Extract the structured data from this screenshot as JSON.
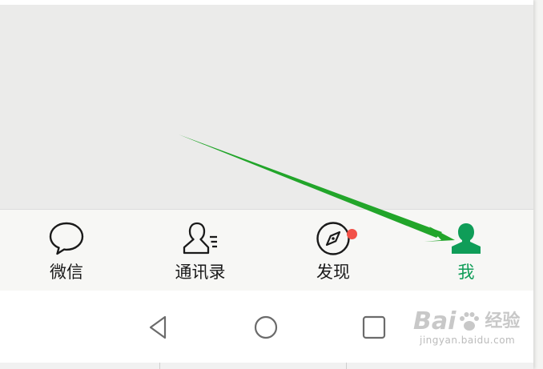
{
  "tabbar": {
    "tabs": [
      {
        "label": "微信",
        "icon": "chat-bubble-icon"
      },
      {
        "label": "通讯录",
        "icon": "contacts-icon"
      },
      {
        "label": "发现",
        "icon": "compass-icon",
        "has_badge": true
      },
      {
        "label": "我",
        "icon": "person-icon",
        "active": true
      }
    ]
  },
  "android_nav": {
    "back": "back-triangle-icon",
    "home": "home-circle-icon",
    "recent": "recent-square-icon"
  },
  "annotation": {
    "type": "arrow",
    "color": "#22a52a",
    "points_to": "我"
  },
  "watermark": {
    "brand": "Bai",
    "brand_suffix": "经验",
    "url": "jingyan.baidu.com"
  },
  "colors": {
    "active": "#0f9d58",
    "badge": "#f25148",
    "tabbar_bg": "#f7f7f5",
    "content_bg": "#ebebea"
  }
}
